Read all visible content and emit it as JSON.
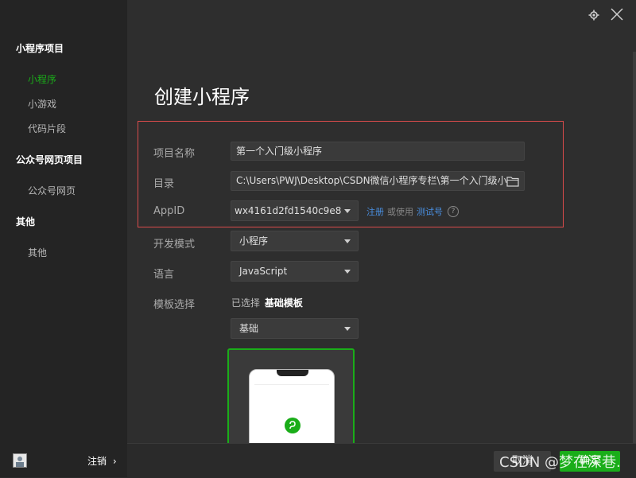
{
  "sidebar": {
    "groups": [
      {
        "label": "小程序项目",
        "items": [
          {
            "label": "小程序",
            "active": true
          },
          {
            "label": "小游戏"
          },
          {
            "label": "代码片段"
          }
        ]
      },
      {
        "label": "公众号网页项目",
        "items": [
          {
            "label": "公众号网页"
          }
        ]
      },
      {
        "label": "其他",
        "items": [
          {
            "label": "其他"
          }
        ]
      }
    ],
    "logout_label": "注销",
    "logout_arrow": "›"
  },
  "header": {
    "title": "创建小程序",
    "icons": [
      "gear-icon",
      "close-icon"
    ]
  },
  "form": {
    "project_name": {
      "label": "项目名称",
      "value": "第一个入门级小程序"
    },
    "directory": {
      "label": "目录",
      "value": "C:\\Users\\PWJ\\Desktop\\CSDN微信小程序专栏\\第一个入门级小"
    },
    "appid": {
      "label": "AppID",
      "value": "wx4161d2fd1540c9e8",
      "register": "注册",
      "or_use": "或使用",
      "test_account": "测试号",
      "help": "?"
    },
    "dev_mode": {
      "label": "开发模式",
      "value": "小程序"
    },
    "language": {
      "label": "语言",
      "value": "JavaScript"
    },
    "template": {
      "label": "模板选择",
      "selected_prefix": "已选择",
      "selected_value": "基础模板",
      "dropdown_value": "基础"
    }
  },
  "footer": {
    "cancel_label": "取消",
    "create_label": "确定"
  },
  "watermark": "CSDN @梦在深巷.",
  "colors": {
    "accent": "#1aad19",
    "highlight_border": "#d94b4b",
    "link": "#4a90e2"
  }
}
